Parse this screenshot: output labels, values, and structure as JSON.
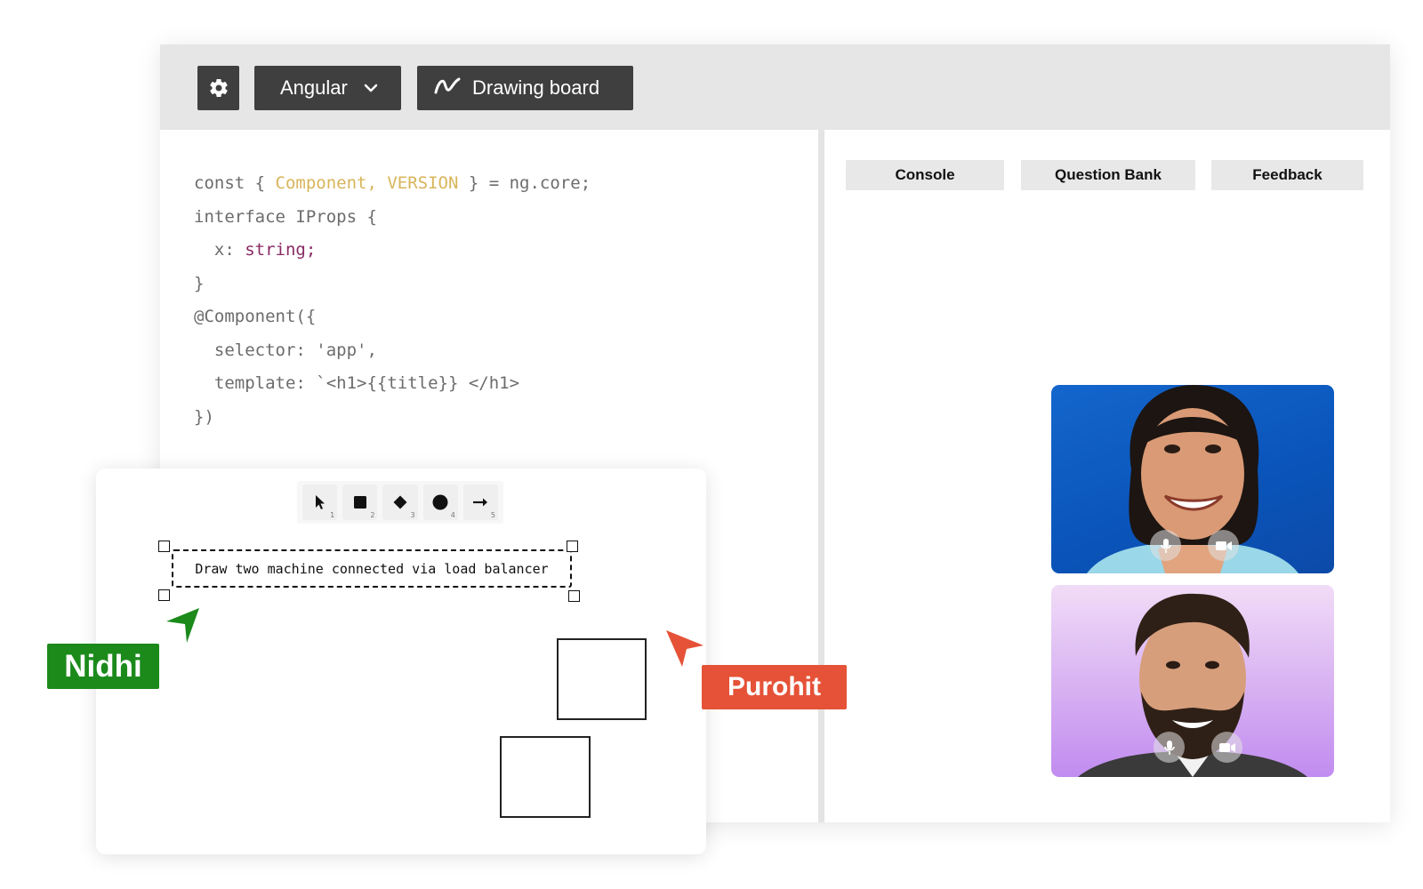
{
  "toolbar": {
    "settings_icon": "gear-icon",
    "framework_label": "Angular",
    "framework_icon": "chevron-down-icon",
    "drawing_label": "Drawing board",
    "drawing_icon": "squiggle-icon"
  },
  "code": {
    "lines": [
      [
        {
          "t": "const { ",
          "c": "plain"
        },
        {
          "t": "Component, VERSION",
          "c": "yellow"
        },
        {
          "t": " } = ng.core;",
          "c": "plain"
        }
      ],
      [
        {
          "t": "interface IProps {",
          "c": "plain"
        }
      ],
      [
        {
          "t": "  x: ",
          "c": "plain"
        },
        {
          "t": "string;",
          "c": "purple"
        }
      ],
      [
        {
          "t": "}",
          "c": "plain"
        }
      ],
      [
        {
          "t": "@Component({",
          "c": "plain"
        }
      ],
      [
        {
          "t": "  selector: 'app',",
          "c": "plain"
        }
      ],
      [
        {
          "t": "  template: `<h1>{{title}} </h1>",
          "c": "plain"
        }
      ],
      [
        {
          "t": "})",
          "c": "plain"
        }
      ]
    ]
  },
  "tabs": {
    "console": "Console",
    "question_bank": "Question Bank",
    "feedback": "Feedback"
  },
  "participants": [
    {
      "name": "participant-1",
      "mic_icon": "microphone-icon",
      "camera_icon": "video-camera-icon"
    },
    {
      "name": "participant-2",
      "mic_icon": "microphone-icon",
      "camera_icon": "video-camera-icon"
    }
  ],
  "drawing_board": {
    "tools": [
      {
        "icon": "select-arrow-icon",
        "shortcut": "1"
      },
      {
        "icon": "rectangle-icon",
        "shortcut": "2"
      },
      {
        "icon": "diamond-icon",
        "shortcut": "3"
      },
      {
        "icon": "circle-icon",
        "shortcut": "4"
      },
      {
        "icon": "arrow-right-icon",
        "shortcut": "5"
      }
    ],
    "text_box": "Draw two machine connected via load balancer"
  },
  "cursors": {
    "nidhi": {
      "label": "Nidhi",
      "color": "#1b8a1b"
    },
    "purohit": {
      "label": "Purohit",
      "color": "#e55237"
    }
  },
  "colors": {
    "toolbar_bg": "#e6e6e6",
    "button_bg": "#3f3f3f",
    "code_keyword": "#d8b55b",
    "code_type": "#8a2a63"
  }
}
